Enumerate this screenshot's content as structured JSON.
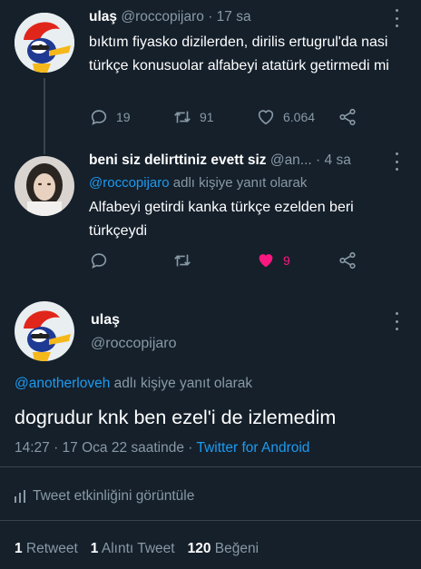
{
  "tweet1": {
    "name": "ulaş",
    "handle": "@roccopijaro",
    "separator": "·",
    "time": "17 sa",
    "text": "bıktım fiyasko dizilerden, dirilis ertugrul'da nasi türkçe konusuolar alfabeyi atatürk getirmedi mi",
    "replies": "19",
    "retweets": "91",
    "likes": "6.064"
  },
  "tweet2": {
    "name": "beni siz delirttiniz evett siz",
    "handle": "@an...",
    "separator": "·",
    "time": "4 sa",
    "reply_to_handle": "@roccopijaro",
    "reply_to_suffix": " adlı kişiye yanıt olarak",
    "text": "Alfabeyi getirdi kanka türkçe ezelden beri türkçeydi",
    "likes": "9",
    "like_color": "#f91880"
  },
  "main": {
    "name": "ulaş",
    "handle": "@roccopijaro",
    "reply_to_handle": "@anotherloveh",
    "reply_to_suffix": " adlı kişiye yanıt olarak",
    "text": "dogrudur knk ben ezel'i de izlemedim",
    "timestamp": "14:27 · 17 Oca 22 saatinde · ",
    "source": "Twitter for Android",
    "activity_label": "Tweet etkinliğini görüntüle",
    "retweet_count": "1",
    "retweet_label": " Retweet",
    "quote_count": "1",
    "quote_label": " Alıntı Tweet",
    "like_count": "120",
    "like_label": " Beğeni"
  },
  "colors": {
    "background": "#15202b",
    "muted": "#8899a6",
    "link": "#1d9bf0",
    "divider": "#38444d"
  }
}
